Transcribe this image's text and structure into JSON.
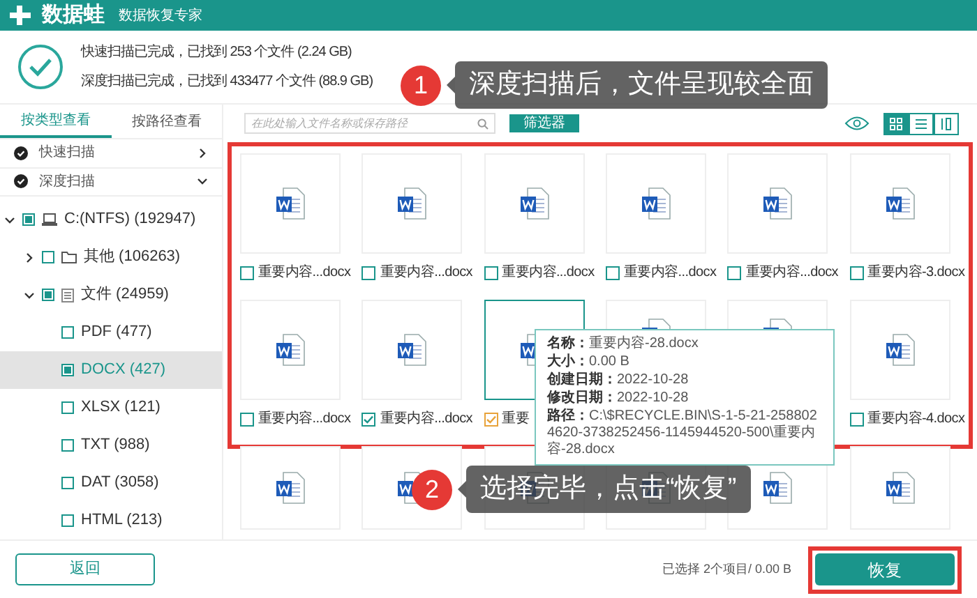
{
  "app": {
    "name": "数据蛙",
    "subtitle": "数据恢复专家"
  },
  "summary": [
    "快速扫描已完成，已找到 253 个文件 (2.24 GB)",
    "深度扫描已完成，已找到 433477 个文件 (88.9 GB)"
  ],
  "sidebar": {
    "tabs": [
      {
        "label": "按类型查看",
        "selected": true
      },
      {
        "label": "按路径查看",
        "selected": false
      }
    ],
    "scans": [
      {
        "label": "快速扫描",
        "expanded": false
      },
      {
        "label": "深度扫描",
        "expanded": true
      }
    ],
    "tree": [
      {
        "label": "C:(NTFS) (192947)",
        "kind": "drive",
        "checked": true,
        "expanded": true,
        "selected": false,
        "children": [
          {
            "label": "其他 (106263)",
            "kind": "folder",
            "checked": false,
            "expanded": false,
            "selected": false
          },
          {
            "label": "文件 (24959)",
            "kind": "document",
            "checked": true,
            "expanded": true,
            "selected": false,
            "children": [
              {
                "label": "PDF (477)",
                "checked": false,
                "selected": false
              },
              {
                "label": "DOCX (427)",
                "checked": true,
                "selected": true
              },
              {
                "label": "XLSX (121)",
                "checked": false,
                "selected": false
              },
              {
                "label": "TXT (988)",
                "checked": false,
                "selected": false
              },
              {
                "label": "DAT (3058)",
                "checked": false,
                "selected": false
              },
              {
                "label": "HTML (213)",
                "checked": false,
                "selected": false
              }
            ]
          }
        ]
      }
    ]
  },
  "toolbar": {
    "search_placeholder": "在此处输入文件名称或保存路径",
    "filter_button": "筛选器",
    "views": [
      {
        "kind": "grid",
        "selected": true
      },
      {
        "kind": "list",
        "selected": false
      },
      {
        "kind": "detail",
        "selected": false
      }
    ]
  },
  "files": [
    {
      "kind": "labeled",
      "name": "重要内容...docx",
      "checked": false,
      "selected": false
    },
    {
      "kind": "labeled",
      "name": "重要内容...docx",
      "checked": false,
      "selected": false
    },
    {
      "kind": "labeled",
      "name": "重要内容...docx",
      "checked": false,
      "selected": false
    },
    {
      "kind": "labeled",
      "name": "重要内容...docx",
      "checked": false,
      "selected": false
    },
    {
      "kind": "labeled",
      "name": "重要内容...docx",
      "checked": false,
      "selected": false
    },
    {
      "kind": "labeled",
      "name": "重要内容-3.docx",
      "checked": false,
      "selected": false
    },
    {
      "kind": "labeled",
      "name": "重要内容...docx",
      "checked": false,
      "selected": false
    },
    {
      "kind": "labeled",
      "name": "重要内容...docx",
      "checked": true,
      "selected": false
    },
    {
      "kind": "labeled",
      "name": "重要",
      "checked": true,
      "selected": true
    },
    {
      "kind": "covered"
    },
    {
      "kind": "covered"
    },
    {
      "kind": "labeled",
      "name": "重要内容-4.docx",
      "checked": false,
      "selected": false
    },
    {
      "kind": "cut"
    },
    {
      "kind": "cut"
    },
    {
      "kind": "cut"
    },
    {
      "kind": "cut"
    },
    {
      "kind": "cut"
    },
    {
      "kind": "cut"
    }
  ],
  "tooltip": [
    {
      "label": "名称：",
      "value": "重要内容-28.docx"
    },
    {
      "label": "大小：",
      "value": "0.00 B"
    },
    {
      "label": "创建日期：",
      "value": "2022-10-28"
    },
    {
      "label": "修改日期：",
      "value": "2022-10-28"
    },
    {
      "label": "路径：",
      "value": "C:\\$RECYCLE.BIN\\S-1-5-21-2588024620-3738252456-1145944520-500\\重要内容-28.docx"
    }
  ],
  "callouts": [
    {
      "number": "1",
      "text": "深度扫描后，文件呈现较全面"
    },
    {
      "number": "2",
      "text": "选择完毕，点击“恢复”"
    }
  ],
  "footer": {
    "back_button": "返回",
    "status": "已选择 2个项目/ 0.00 B",
    "recover_button": "恢复"
  }
}
